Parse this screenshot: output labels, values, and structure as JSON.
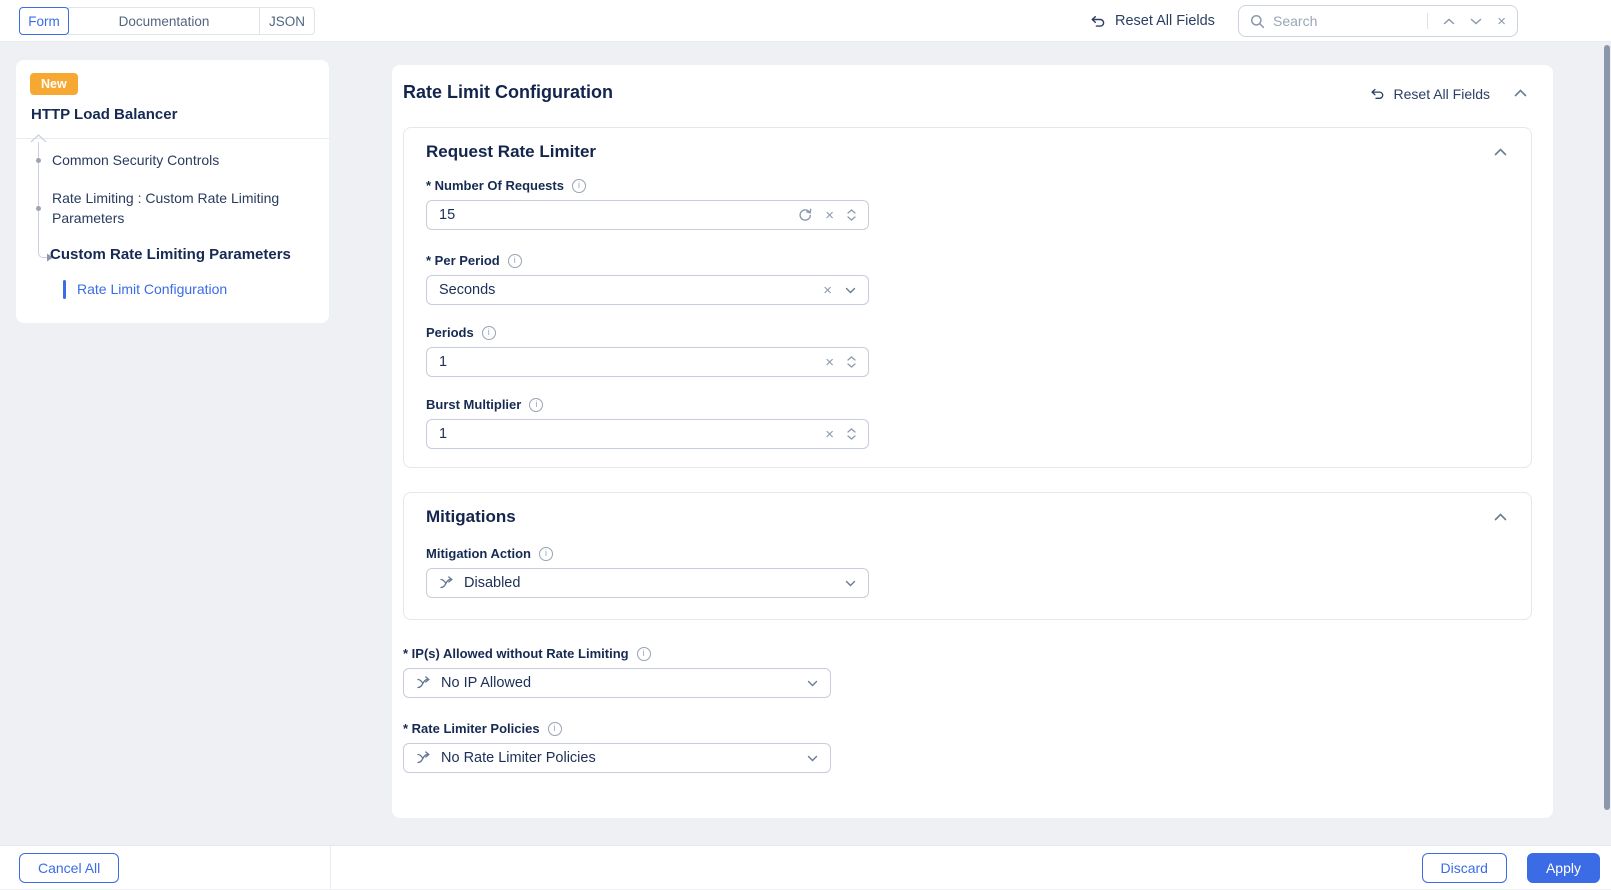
{
  "topbar": {
    "tabs": [
      {
        "label": "Form"
      },
      {
        "label": "Documentation"
      },
      {
        "label": "JSON"
      }
    ],
    "reset_all_label": "Reset All Fields",
    "search": {
      "placeholder": "Search"
    }
  },
  "sidebar": {
    "badge": "New",
    "title": "HTTP Load Balancer",
    "items": [
      {
        "label": "Common Security Controls"
      },
      {
        "label": "Rate Limiting : Custom Rate Limiting Parameters"
      },
      {
        "label": "Custom Rate Limiting Parameters"
      },
      {
        "label": "Rate Limit Configuration"
      }
    ]
  },
  "panel": {
    "title": "Rate Limit Configuration",
    "reset_label": "Reset All Fields",
    "request_rate_limiter": {
      "title": "Request Rate Limiter",
      "fields": [
        {
          "label": "* Number Of Requests",
          "value": "15"
        },
        {
          "label": "* Per Period",
          "value": "Seconds"
        },
        {
          "label": "Periods",
          "value": "1"
        },
        {
          "label": "Burst Multiplier",
          "value": "1"
        }
      ]
    },
    "mitigations": {
      "title": "Mitigations",
      "fields": [
        {
          "label": "Mitigation Action",
          "value": "Disabled"
        }
      ]
    },
    "bottom_fields": [
      {
        "label": "* IP(s) Allowed without Rate Limiting",
        "value": "No IP Allowed"
      },
      {
        "label": "* Rate Limiter Policies",
        "value": "No Rate Limiter Policies"
      }
    ]
  },
  "footer": {
    "cancel_all_label": "Cancel All",
    "discard_label": "Discard",
    "apply_label": "Apply"
  },
  "icons": {
    "clear": "×",
    "info": "i"
  },
  "colors": {
    "accent_blue": "#3b6ce5",
    "badge_orange": "#f7a832",
    "heading_navy": "#13254d",
    "page_background": "#eef0f4"
  }
}
